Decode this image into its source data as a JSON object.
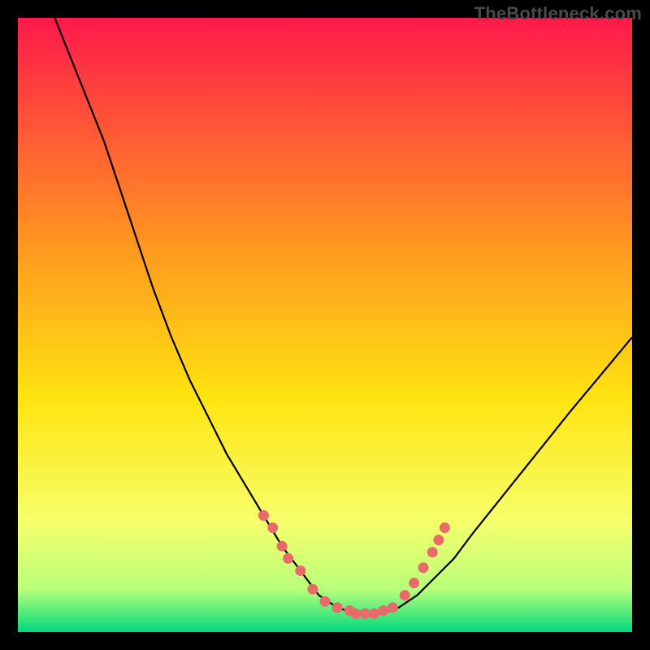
{
  "watermark": "TheBottleneck.com",
  "chart_data": {
    "type": "line",
    "title": "",
    "xlabel": "",
    "ylabel": "",
    "xlim": [
      0,
      100
    ],
    "ylim": [
      0,
      100
    ],
    "gradient_colors": {
      "top": "#ff1a4b",
      "upper_mid": "#ff9a1f",
      "mid": "#ffe411",
      "lower_mid": "#f6ff6b",
      "low": "#b8ff7a",
      "bottom": "#00d97e"
    },
    "series": [
      {
        "name": "curve",
        "color": "#000000",
        "x": [
          6,
          8,
          10,
          12,
          14,
          16,
          18,
          20,
          22,
          25,
          28,
          31,
          34,
          37,
          40,
          43,
          46,
          49,
          52,
          55,
          57,
          59,
          62,
          65,
          68,
          71,
          74,
          78,
          82,
          86,
          90,
          95,
          100
        ],
        "y": [
          100,
          95,
          90,
          85,
          80,
          74,
          68,
          62,
          56,
          48,
          41,
          35,
          29,
          24,
          19,
          14,
          10,
          6,
          4,
          3,
          3,
          3,
          4,
          6,
          9,
          12,
          16,
          21,
          26,
          31,
          36,
          42,
          48
        ]
      },
      {
        "name": "dotted-markers",
        "color": "#e86a6a",
        "type": "scatter",
        "x": [
          40,
          41.5,
          43,
          44,
          46,
          48,
          50,
          52,
          54,
          55,
          56.5,
          58,
          59.5,
          61,
          63,
          64.5,
          66,
          67.5,
          68.5,
          69.5
        ],
        "y": [
          19,
          17,
          14,
          12,
          10,
          7,
          5,
          4,
          3.5,
          3,
          3,
          3,
          3.5,
          4,
          6,
          8,
          10.5,
          13,
          15,
          17
        ]
      }
    ]
  }
}
